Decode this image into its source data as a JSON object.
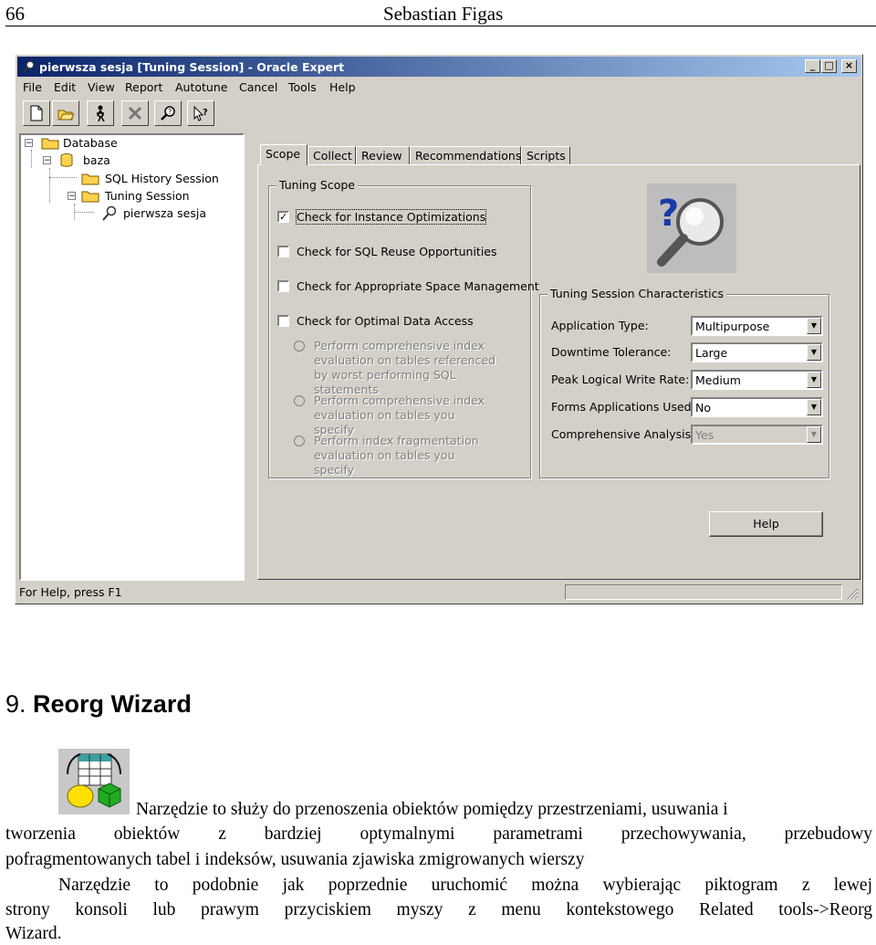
{
  "page_header": {
    "page_number": "66",
    "author": "Sebastian Figas"
  },
  "window": {
    "title": "pierwsza sesja [Tuning Session] - Oracle Expert",
    "title_buttons": [
      "_",
      "□",
      "×"
    ],
    "menu": [
      "File",
      "Edit",
      "View",
      "Report",
      "Autotune",
      "Cancel",
      "Tools",
      "Help"
    ],
    "toolbar_icons": [
      "new-icon",
      "open-icon",
      "run-icon",
      "delete-icon",
      "find-icon",
      "context-help-icon"
    ],
    "tree": [
      {
        "label": "Database",
        "icon": "folder-icon",
        "expander": "−"
      },
      {
        "label": "baza",
        "icon": "database-icon",
        "expander": "−"
      },
      {
        "label": "SQL History Session",
        "icon": "folder-icon"
      },
      {
        "label": "Tuning Session",
        "icon": "folder-icon",
        "expander": "−"
      },
      {
        "label": "pierwsza sesja",
        "icon": "magnifier-icon"
      }
    ],
    "tabs": [
      "Scope",
      "Collect",
      "Review",
      "Recommendations",
      "Scripts"
    ],
    "active_tab": "Scope",
    "tuning_scope": {
      "title": "Tuning Scope",
      "checks": [
        {
          "label": "Check for Instance Optimizations",
          "checked": true
        },
        {
          "label": "Check for SQL Reuse Opportunities",
          "checked": false
        },
        {
          "label": "Check for Appropriate Space Management",
          "checked": false
        },
        {
          "label": "Check for Optimal Data Access",
          "checked": false
        }
      ],
      "radios": [
        "Perform comprehensive index evaluation on tables referenced by worst performing SQL statements",
        "Perform comprehensive index evaluation on tables you specify",
        "Perform index fragmentation evaluation on tables you specify"
      ]
    },
    "characteristics": {
      "title": "Tuning Session Characteristics",
      "fields": [
        {
          "label": "Application Type:",
          "value": "Multipurpose",
          "disabled": false
        },
        {
          "label": "Downtime Tolerance:",
          "value": "Large",
          "disabled": false
        },
        {
          "label": "Peak Logical Write Rate:",
          "value": "Medium",
          "disabled": false
        },
        {
          "label": "Forms Applications Used:",
          "value": "No",
          "disabled": false
        },
        {
          "label": "Comprehensive Analysis:",
          "value": "Yes",
          "disabled": true
        }
      ]
    },
    "help_button": "Help",
    "status_text": "For Help, press F1"
  },
  "section": {
    "number": "9.",
    "title": "Reorg Wizard"
  },
  "body": {
    "line1": "Narzędzie to służy do przenoszenia obiektów pomiędzy przestrzeniami, usuwania i",
    "line2": "tworzenia obiektów z bardziej optymalnymi parametrami przechowywania, przebudowy",
    "line3": "pofragmentowanych tabel i indeksów, usuwania zjawiska zmigrowanych wierszy",
    "line4": "Narzędzie to podobnie jak poprzednie uruchomić można wybierając piktogram z lewej",
    "line5": "strony konsoli lub prawym przyciskiem myszy z menu kontekstowego Related tools->Reorg",
    "line6": "Wizard."
  }
}
